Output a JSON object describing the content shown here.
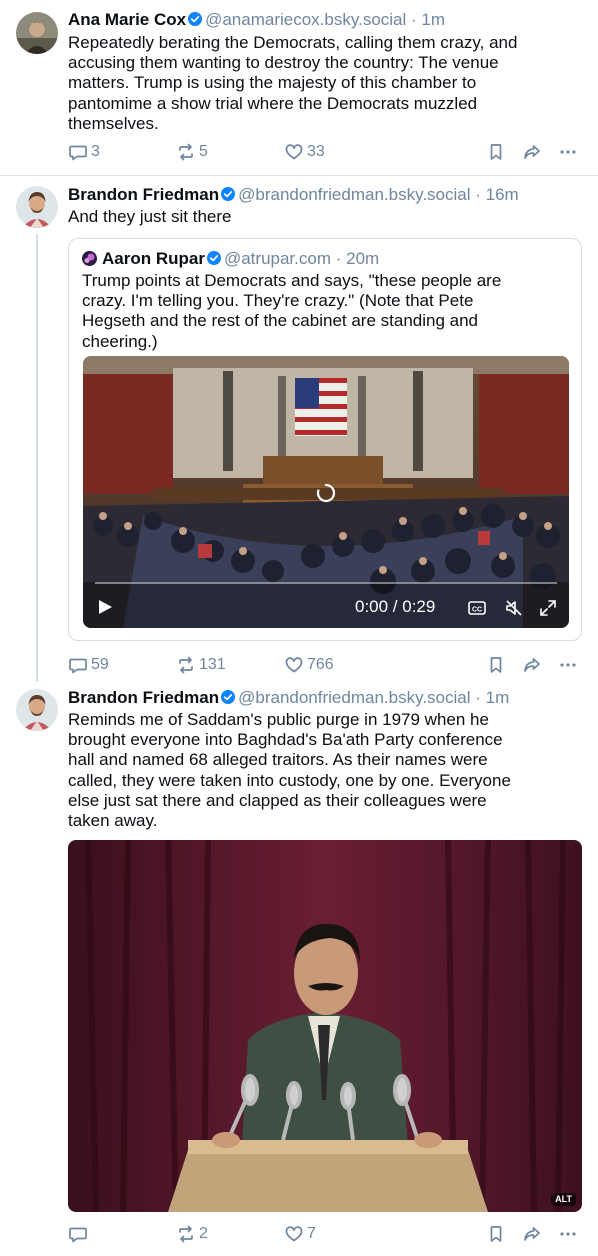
{
  "posts": [
    {
      "author_name": "Ana Marie Cox",
      "handle": "@anamariecox.bsky.social",
      "time": "1m",
      "text_lines": [
        "Repeatedly berating the Democrats, calling them crazy, and",
        "accusing them wanting to destroy the country: The venue",
        "matters. Trump is using the majesty of this chamber to",
        "pantomime a show trial where the Democrats muzzled",
        "themselves."
      ],
      "replies": "3",
      "reposts": "5",
      "likes": "33"
    },
    {
      "author_name": "Brandon Friedman",
      "handle": "@brandonfriedman.bsky.social",
      "time": "16m",
      "text_lines": [
        "And they just sit there"
      ],
      "quote": {
        "author_name": "Aaron Rupar",
        "handle": "@atrupar.com",
        "time": "20m",
        "text_lines": [
          "Trump points at Democrats and says, \"these people are",
          "crazy. I'm telling you. They're crazy.\" (Note that Pete",
          "Hegseth and the rest of the cabinet are standing and",
          "cheering.)"
        ],
        "video_time": "0:00 / 0:29"
      },
      "replies": "59",
      "reposts": "131",
      "likes": "766"
    },
    {
      "author_name": "Brandon Friedman",
      "handle": "@brandonfriedman.bsky.social",
      "time": "1m",
      "text_lines": [
        "Reminds me of Saddam's public purge in 1979 when he",
        "brought everyone into Baghdad's Ba'ath Party conference",
        "hall and named 68 alleged traitors. As their names were",
        "called, they were taken into custody, one by one. Everyone",
        "else just sat there and clapped as their colleagues were",
        "taken away."
      ],
      "image_badge": "ALT",
      "replies": "",
      "reposts": "2",
      "likes": "7"
    }
  ],
  "colors": {
    "accent": "#1083fe",
    "muted": "#6f869f",
    "border": "#d4dde6"
  },
  "icons": [
    "verified-badge-icon",
    "reply-icon",
    "repost-icon",
    "like-icon",
    "bookmark-icon",
    "share-icon",
    "more-icon",
    "play-icon",
    "captions-icon",
    "mute-icon",
    "fullscreen-icon",
    "loading-spinner-icon"
  ]
}
